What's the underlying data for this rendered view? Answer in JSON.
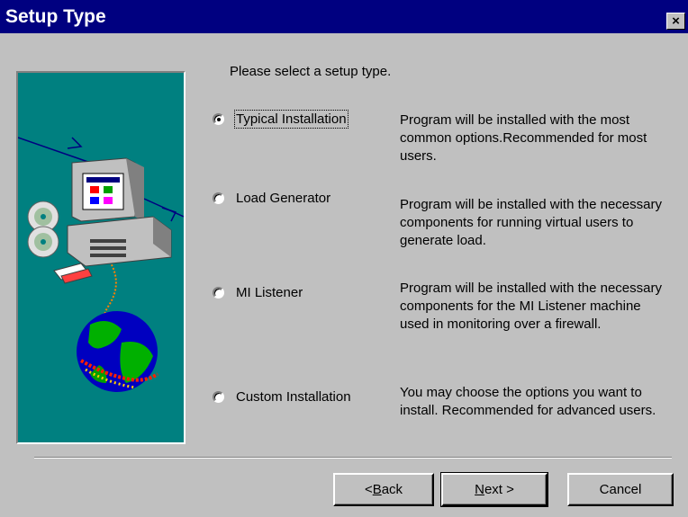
{
  "window": {
    "title": "Setup Type",
    "close_glyph": "×"
  },
  "prompt": "Please select a setup type.",
  "options": [
    {
      "label": "Typical Installation",
      "selected": true,
      "description": "Program will be installed with the most common options.Recommended for most users."
    },
    {
      "label": "Load Generator",
      "selected": false,
      "description": "Program will be installed with the necessary components for running virtual users to generate load."
    },
    {
      "label": "MI Listener",
      "selected": false,
      "description": "Program will be installed with the necessary components for the MI Listener machine used in monitoring over a firewall."
    },
    {
      "label": "Custom Installation",
      "selected": false,
      "description": "You may choose the options you want to install. Recommended for advanced users."
    }
  ],
  "buttons": {
    "back_prefix": "< ",
    "back_mnemonic": "B",
    "back_rest": "ack",
    "next_mnemonic": "N",
    "next_rest": "ext >",
    "cancel": "Cancel"
  },
  "colors": {
    "titlebar": "#000080",
    "face": "#c0c0c0",
    "illustration_bg": "#008080"
  },
  "icons": [
    "close-icon",
    "computer-icon",
    "cd-icon",
    "floppy-icon",
    "globe-icon"
  ]
}
